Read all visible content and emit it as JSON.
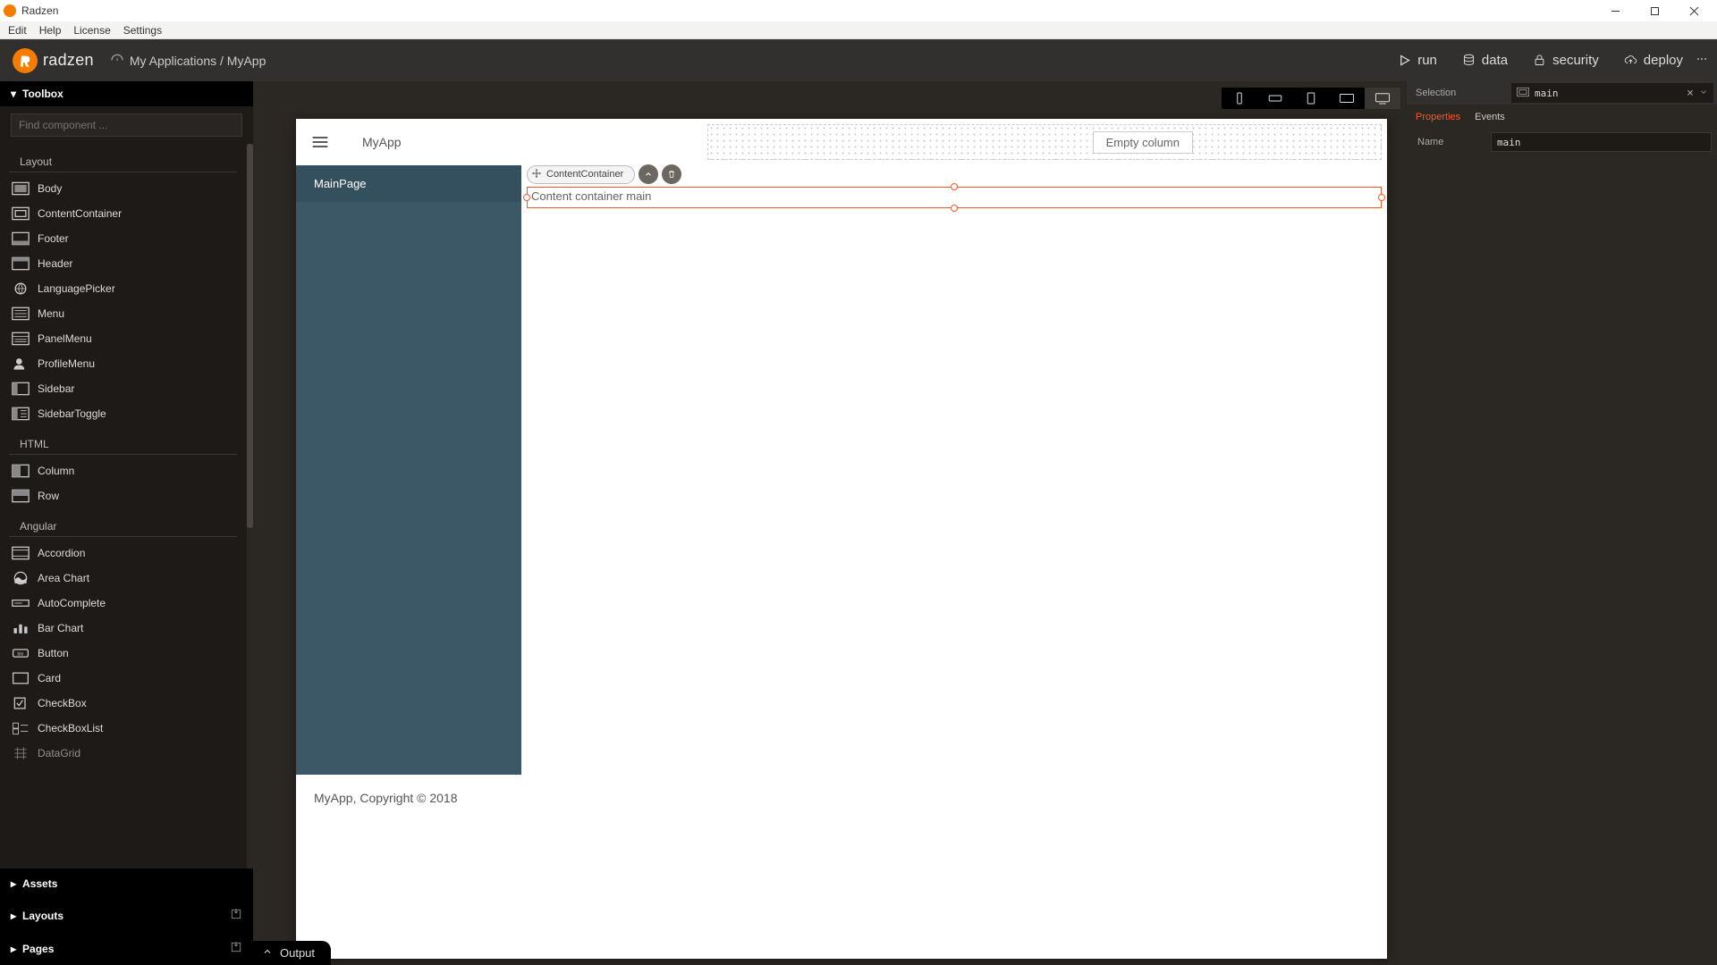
{
  "window": {
    "title": "Radzen"
  },
  "menubar": [
    "Edit",
    "Help",
    "License",
    "Settings"
  ],
  "header": {
    "brand": "radzen",
    "breadcrumb": "My Applications / MyApp",
    "actions": {
      "run": "run",
      "data": "data",
      "security": "security",
      "deploy": "deploy"
    }
  },
  "toolbox": {
    "title": "Toolbox",
    "search_placeholder": "Find component ...",
    "sections": {
      "layout": {
        "title": "Layout",
        "items": [
          "Body",
          "ContentContainer",
          "Footer",
          "Header",
          "LanguagePicker",
          "Menu",
          "PanelMenu",
          "ProfileMenu",
          "Sidebar",
          "SidebarToggle"
        ]
      },
      "html": {
        "title": "HTML",
        "items": [
          "Column",
          "Row"
        ]
      },
      "angular": {
        "title": "Angular",
        "items": [
          "Accordion",
          "Area Chart",
          "AutoComplete",
          "Bar Chart",
          "Button",
          "Card",
          "CheckBox",
          "CheckBoxList",
          "DataGrid"
        ]
      }
    },
    "bottom": {
      "assets": "Assets",
      "layouts": "Layouts",
      "pages": "Pages"
    }
  },
  "canvas": {
    "empty_column": "Empty column",
    "app_title": "MyApp",
    "nav_item": "MainPage",
    "selection_label": "ContentContainer",
    "selected_text": "Content container main",
    "footer": "MyApp, Copyright © 2018"
  },
  "output": {
    "label": "Output"
  },
  "right": {
    "selection_label": "Selection",
    "selection_value": "main",
    "tabs": {
      "properties": "Properties",
      "events": "Events"
    },
    "prop_name_label": "Name",
    "prop_name_value": "main"
  }
}
